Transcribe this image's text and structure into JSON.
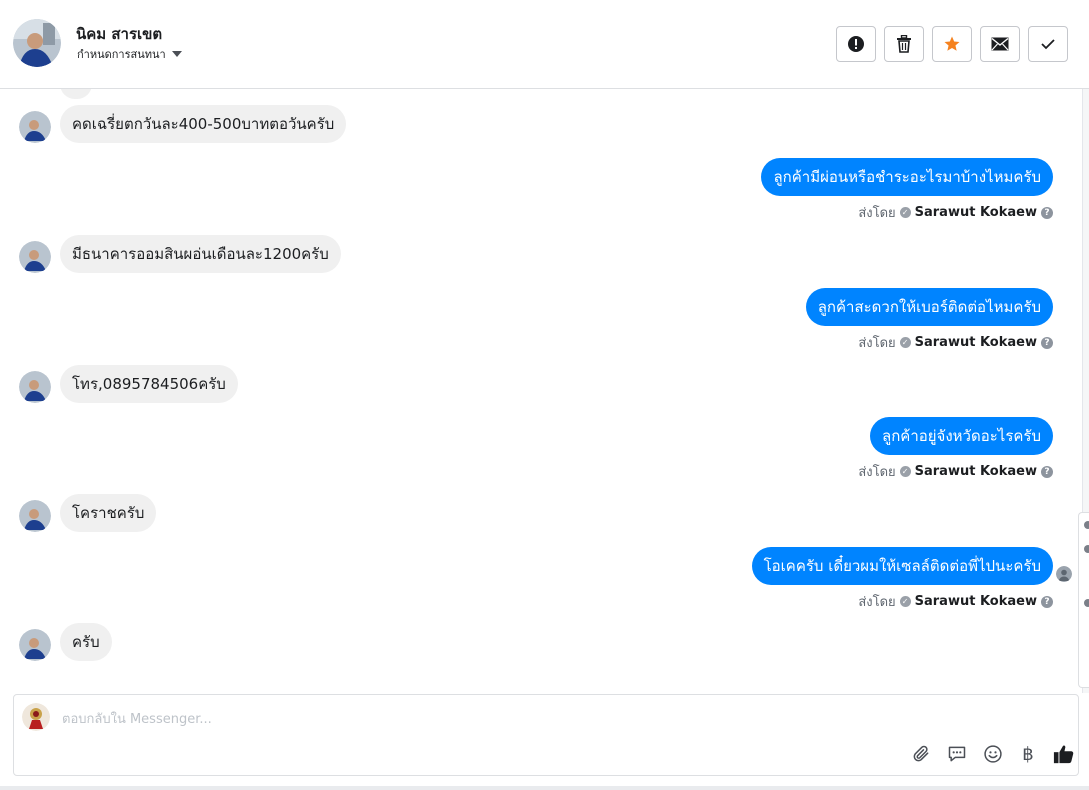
{
  "header": {
    "contact_name": "นิคม สารเขต",
    "subtitle": "กำหนดการสนทนา",
    "actions": [
      {
        "name": "report-button",
        "icon": "exclamation-icon"
      },
      {
        "name": "delete-button",
        "icon": "trash-icon"
      },
      {
        "name": "star-button",
        "icon": "star-icon",
        "color": "#f5821f"
      },
      {
        "name": "mark-unread-button",
        "icon": "envelope-icon"
      },
      {
        "name": "mark-done-button",
        "icon": "checkmark-icon"
      }
    ]
  },
  "messages": [
    {
      "direction": "in",
      "text": "คดเฉรี่ยตกวันละ400-500บาทตอวันครับ"
    },
    {
      "direction": "out",
      "text": "ลูกค้ามีผ่อนหรือชำระอะไรมาบ้างไหมครับ",
      "sent_by_label": "ส่งโดย",
      "sender": "Sarawut Kokaew"
    },
    {
      "direction": "in",
      "text": "มีธนาคารออมสินผอ่นเดือนละ1200ครับ"
    },
    {
      "direction": "out",
      "text": "ลูกค้าสะดวกให้เบอร์ติดต่อไหมครับ",
      "sent_by_label": "ส่งโดย",
      "sender": "Sarawut Kokaew"
    },
    {
      "direction": "in",
      "text": "โทร,0895784506ครับ"
    },
    {
      "direction": "out",
      "text": "ลูกค้าอยู่จังหวัดอะไรครับ",
      "sent_by_label": "ส่งโดย",
      "sender": "Sarawut Kokaew"
    },
    {
      "direction": "in",
      "text": "โคราชครับ"
    },
    {
      "direction": "out",
      "text": "โอเคครับ เดี๋ยวผมให้เซลล์ติดต่อพี่ไปนะครับ",
      "sent_by_label": "ส่งโดย",
      "sender": "Sarawut Kokaew"
    },
    {
      "direction": "in",
      "text": "ครับ"
    }
  ],
  "composer": {
    "placeholder": "ตอบกลับใน Messenger...",
    "value": "",
    "icons": [
      "paperclip-icon",
      "saved-reply-icon",
      "emoji-icon",
      "baht-icon",
      "thumbs-up-icon"
    ],
    "baht_glyph": "฿"
  },
  "colors": {
    "outgoing_bubble": "#0084ff",
    "incoming_bubble": "#f0f0f0",
    "star_accent": "#f5821f"
  }
}
